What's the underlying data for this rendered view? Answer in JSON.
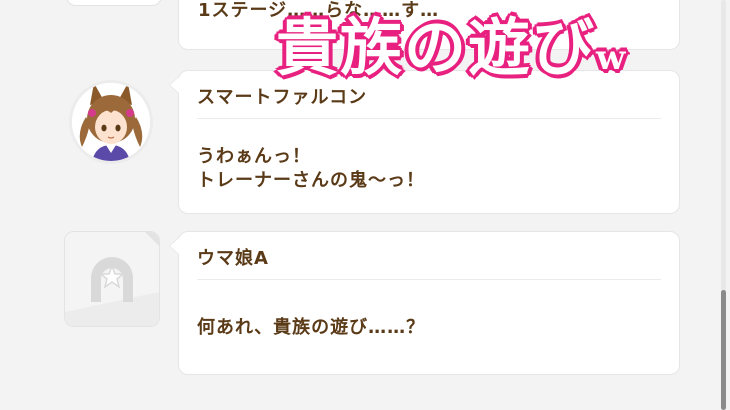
{
  "overlay": {
    "caption_main": "貴族の遊び",
    "caption_suffix": "w",
    "color": "#e8207f"
  },
  "dialog": {
    "top_partial": {
      "text": "1ステージ……らな……す…"
    },
    "entries": [
      {
        "speaker": "スマートファルコン",
        "line1": "うわぁんっ！",
        "line2": "トレーナーさんの鬼～っ！",
        "avatar": "smart-falcon-portrait"
      },
      {
        "speaker": "ウマ娘A",
        "line1": "何あれ、貴族の遊び……？",
        "avatar": "horseshoe-placeholder"
      }
    ]
  },
  "colors": {
    "text": "#5a3a17",
    "background": "#f3f3f3",
    "bubble": "#ffffff"
  }
}
